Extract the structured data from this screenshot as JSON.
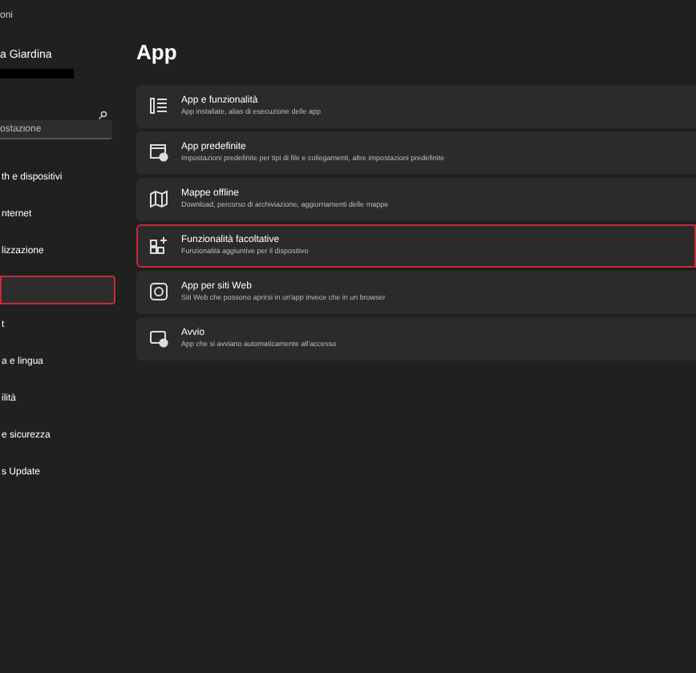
{
  "window": {
    "title": "oni"
  },
  "account": {
    "name": "a Giardina"
  },
  "search": {
    "value": "ostazione"
  },
  "sidebar": {
    "items": [
      {
        "label": "th e dispositivi",
        "selected": false,
        "highlighted": false
      },
      {
        "label": "nternet",
        "selected": false,
        "highlighted": false
      },
      {
        "label": "lizzazione",
        "selected": false,
        "highlighted": false
      },
      {
        "selected": true,
        "highlighted": true
      },
      {
        "label": "t",
        "selected": false,
        "highlighted": false
      },
      {
        "label": "a e lingua",
        "selected": false,
        "highlighted": false
      },
      {
        "label": "ilità",
        "selected": false,
        "highlighted": false
      },
      {
        "label": "e sicurezza",
        "selected": false,
        "highlighted": false
      },
      {
        "label": "s Update",
        "selected": false,
        "highlighted": false
      }
    ]
  },
  "page": {
    "title": "App",
    "items": [
      {
        "kind": "list",
        "title": "App e funzionalità",
        "subtitle": "App installate, alias di esecuzione delle app",
        "highlighted": false
      },
      {
        "kind": "defaults",
        "title": "App predefinite",
        "subtitle": "Impostazioni predefinite per tipi di file e collegamenti, altre impostazioni predefinite",
        "highlighted": false
      },
      {
        "kind": "map",
        "title": "Mappe offline",
        "subtitle": "Download, percorso di archiviazione, aggiornamenti delle mappe",
        "highlighted": false
      },
      {
        "kind": "grid",
        "title": "Funzionalità facoltative",
        "subtitle": "Funzionalità aggiuntive per il dispositivo",
        "highlighted": true
      },
      {
        "kind": "web",
        "title": "App per siti Web",
        "subtitle": "Siti Web che possono aprirsi in un'app invece che in un browser",
        "highlighted": false
      },
      {
        "kind": "startup",
        "title": "Avvio",
        "subtitle": "App che si avviano automaticamente all'accesso",
        "highlighted": false
      }
    ]
  }
}
